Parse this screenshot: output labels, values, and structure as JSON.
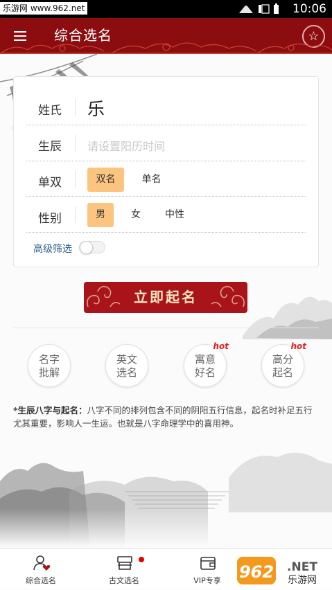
{
  "statusbar": {
    "watermark": "乐游网 www.962.net",
    "time": "10:06"
  },
  "appbar": {
    "title": "综合选名",
    "menu_icon": "menu-icon",
    "fav_icon": "star-icon"
  },
  "form": {
    "surname_label": "姓氏",
    "surname_value": "乐",
    "birth_label": "生辰",
    "birth_placeholder": "请设置阳历时间",
    "count_label": "单双",
    "count_options": [
      "双名",
      "单名"
    ],
    "count_selected": "双名",
    "gender_label": "性别",
    "gender_options": [
      "男",
      "女",
      "中性"
    ],
    "gender_selected": "男",
    "advanced_label": "高级筛选",
    "advanced_enabled": false
  },
  "cta": {
    "label": "立即起名"
  },
  "features": [
    {
      "line1": "名字",
      "line2": "批解",
      "badge": ""
    },
    {
      "line1": "英文",
      "line2": "选名",
      "badge": ""
    },
    {
      "line1": "寓意",
      "line2": "好名",
      "badge": "hot"
    },
    {
      "line1": "高分",
      "line2": "起名",
      "badge": "hot"
    }
  ],
  "description": {
    "title": "*生辰八字与起名：",
    "body": "八字不同的排列包含不同的阴阳五行信息，起名时补足五行尤其重要，影响人一生运。也就是八字命理学中的喜用神。"
  },
  "tabs": [
    {
      "label": "综合选名",
      "icon": "person-heart-icon"
    },
    {
      "label": "古文选名",
      "icon": "book-stand-icon"
    },
    {
      "label": "VIP专享",
      "icon": "wallet-icon"
    }
  ],
  "overlay_logo": {
    "text": "962.NET",
    "subtext": "乐游网"
  },
  "colors": {
    "primary": "#8c0d0f",
    "selected": "#fcc57f",
    "link": "#2e5e8e",
    "hot": "#e02020"
  }
}
